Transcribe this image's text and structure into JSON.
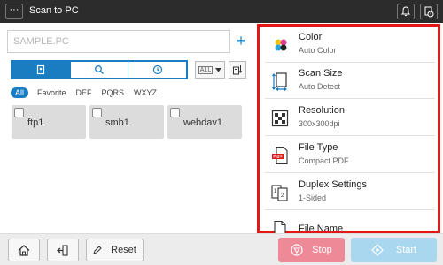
{
  "topbar": {
    "menu_label": "···",
    "title": "Scan to PC",
    "icons": [
      "bell-icon",
      "job-status-icon"
    ]
  },
  "address": {
    "placeholder": "SAMPLE.PC",
    "add_button_label": "+"
  },
  "search_modes": [
    "address-book-icon",
    "search-icon",
    "history-icon"
  ],
  "list_dropdown": {
    "value": "ALL"
  },
  "filters": [
    "All",
    "Favorite",
    "DEF",
    "PQRS",
    "WXYZ"
  ],
  "destinations": [
    {
      "name": "ftp1"
    },
    {
      "name": "smb1"
    },
    {
      "name": "webdav1"
    }
  ],
  "settings": [
    {
      "title": "Color",
      "value": "Auto Color",
      "icon": "color-icon"
    },
    {
      "title": "Scan Size",
      "value": "Auto Detect",
      "icon": "scan-size-icon"
    },
    {
      "title": "Resolution",
      "value": "300x300dpi",
      "icon": "resolution-icon"
    },
    {
      "title": "File Type",
      "value": "Compact PDF",
      "icon": "pdf-icon"
    },
    {
      "title": "Duplex Settings",
      "value": "1-Sided",
      "icon": "duplex-icon"
    },
    {
      "title": "File Name",
      "value": "",
      "icon": "file-icon"
    }
  ],
  "bottombar": {
    "home_icon": "home-icon",
    "exit_icon": "exit-icon",
    "reset_label": "Reset",
    "stop_label": "Stop",
    "start_label": "Start"
  },
  "colors": {
    "accent": "#1a7dc2",
    "highlight_border": "#e21818",
    "stop": "#ee8a98",
    "start": "#a9d7ef"
  }
}
